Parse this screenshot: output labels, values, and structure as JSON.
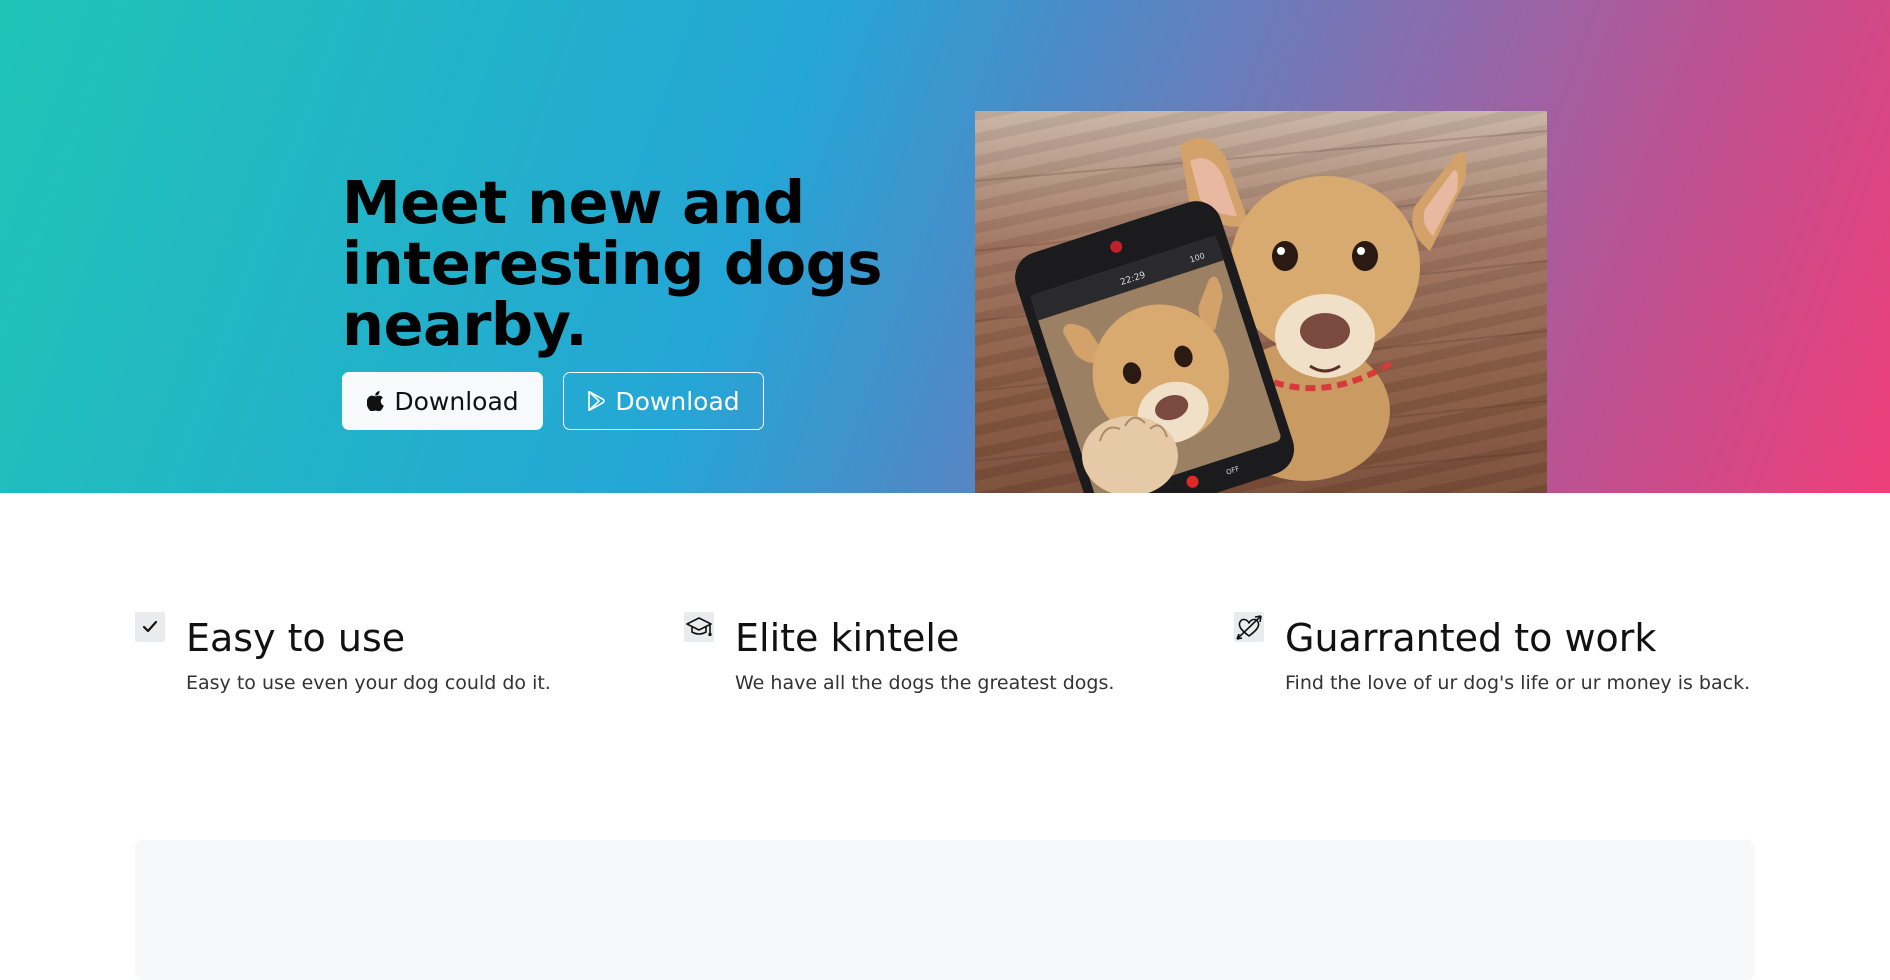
{
  "hero": {
    "title": "Meet new and interesting dogs nearby.",
    "buttons": [
      {
        "label": "Download",
        "icon": "apple-icon"
      },
      {
        "label": "Download",
        "icon": "google-play-icon"
      }
    ],
    "image_alt": "dog-selfie-photo",
    "phone_screen": {
      "time": "22:29",
      "battery": "100",
      "on_label": "ON",
      "off_label": "OFF"
    },
    "colors": {
      "gradient_start": "#20c4b6",
      "gradient_mid": "#24a6d6",
      "gradient_end": "#ee3f7a"
    }
  },
  "features": [
    {
      "icon": "check-icon",
      "title": "Easy to use",
      "text": "Easy to use even your dog could do it."
    },
    {
      "icon": "graduation-cap-icon",
      "title": "Elite kintele",
      "text": "We have all the dogs the greatest dogs."
    },
    {
      "icon": "heart-arrow-icon",
      "title": "Guarranted to work",
      "text": "Find the love of ur dog's life or ur money is back."
    }
  ]
}
